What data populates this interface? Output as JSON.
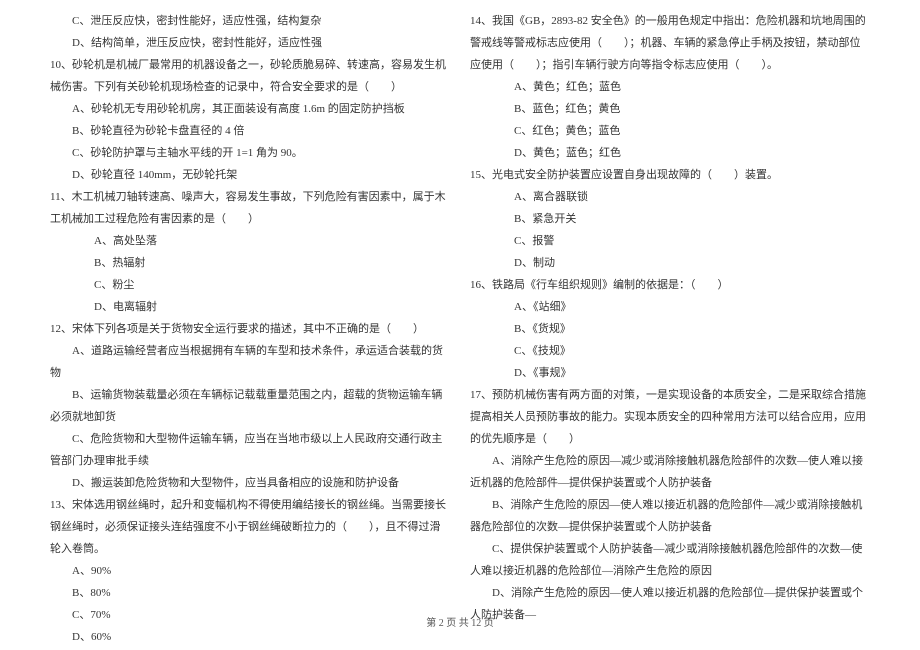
{
  "left": {
    "l1": "C、泄压反应快，密封性能好，适应性强，结构复杂",
    "l2": "D、结构简单，泄压反应快，密封性能好，适应性强",
    "q10": "10、砂轮机是机械厂最常用的机器设备之一，砂轮质脆易碎、转速高，容易发生机械伤害。下列有关砂轮机现场检查的记录中，符合安全要求的是（　　）",
    "q10a": "A、砂轮机无专用砂轮机房，其正面装设有高度 1.6m 的固定防护挡板",
    "q10b": "B、砂轮直径为砂轮卡盘直径的 4 倍",
    "q10c": "C、砂轮防护罩与主轴水平线的开 1=1 角为 90。",
    "q10d": "D、砂轮直径 140mm，无砂轮托架",
    "q11": "11、木工机械刀轴转速高、噪声大，容易发生事故，下列危险有害因素中，属于木工机械加工过程危险有害因素的是（　　）",
    "q11a": "A、高处坠落",
    "q11b": "B、热辐射",
    "q11c": "C、粉尘",
    "q11d": "D、电离辐射",
    "q12": "12、宋体下列各项是关于货物安全运行要求的描述，其中不正确的是（　　）",
    "q12a": "A、道路运输经营者应当根据拥有车辆的车型和技术条件，承运适合装载的货物",
    "q12b": "B、运输货物装载量必须在车辆标记载载重量范围之内，超载的货物运输车辆必须就地卸货",
    "q12c": "C、危险货物和大型物件运输车辆，应当在当地市级以上人民政府交通行政主管部门办理审批手续",
    "q12d": "D、搬运装卸危险货物和大型物件，应当具备相应的设施和防护设备",
    "q13": "13、宋体选用钢丝绳时，起升和变幅机构不得使用编结接长的钢丝绳。当需要接长钢丝绳时，必须保证接头连结强度不小于钢丝绳破断拉力的（　　），且不得过滑轮入卷筒。",
    "q13a": "A、90%",
    "q13b": "B、80%",
    "q13c": "C、70%",
    "q13d": "D、60%"
  },
  "right": {
    "q14": "14、我国《GB，2893-82 安全色》的一般用色规定中指出：危险机器和坑地周围的警戒线等警戒标志应使用（　　）；机器、车辆的紧急停止手柄及按钮，禁动部位应使用（　　）；指引车辆行驶方向等指令标志应使用（　　）。",
    "q14a": "A、黄色；红色；蓝色",
    "q14b": "B、蓝色；红色；黄色",
    "q14c": "C、红色；黄色；蓝色",
    "q14d": "D、黄色；蓝色；红色",
    "q15": "15、光电式安全防护装置应设置自身出现故障的（　　）装置。",
    "q15a": "A、离合器联锁",
    "q15b": "B、紧急开关",
    "q15c": "C、报警",
    "q15d": "D、制动",
    "q16": "16、铁路局《行车组织规则》编制的依据是：（　　）",
    "q16a": "A、《站细》",
    "q16b": "B、《货规》",
    "q16c": "C、《技规》",
    "q16d": "D、《事规》",
    "q17": "17、预防机械伤害有两方面的对策，一是实现设备的本质安全，二是采取综合措施提高相关人员预防事故的能力。实现本质安全的四种常用方法可以结合应用，应用的优先顺序是（　　）",
    "q17a": "A、消除产生危险的原因—减少或消除接触机器危险部件的次数—使人难以接近机器的危险部件—提供保护装置或个人防护装备",
    "q17b": "B、消除产生危险的原因—使人难以接近机器的危险部件—减少或消除接触机器危险部位的次数—提供保护装置或个人防护装备",
    "q17c": "C、提供保护装置或个人防护装备—减少或消除接触机器危险部件的次数—使人难以接近机器的危险部位—消除产生危险的原因",
    "q17d": "D、消除产生危险的原因—使人难以接近机器的危险部位—提供保护装置或个人防护装备—"
  },
  "footer": "第 2 页 共 12 页"
}
